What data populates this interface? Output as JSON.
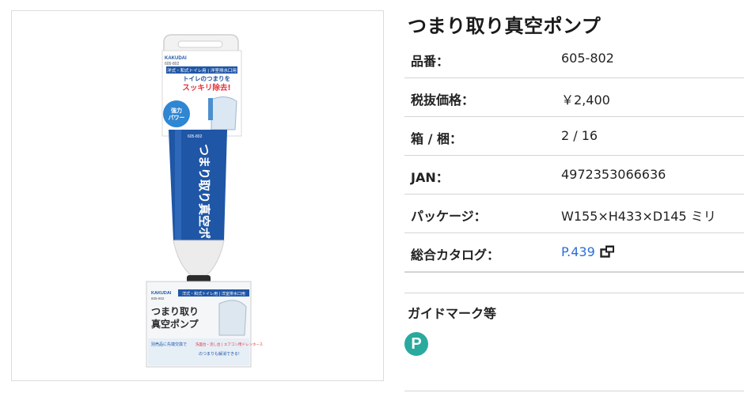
{
  "product": {
    "title": "つまり取り真空ポンプ",
    "image_alt": "つまり取り真空ポンプ",
    "package": {
      "brand": "KAKUDAI",
      "model": "605-802",
      "top_banner": "洋式・和式トイレ用 | 洋室排水口用",
      "headline_1": "トイレのつまりを",
      "headline_2": "スッキリ除去!",
      "badge_line1": "強力",
      "badge_line2": "パワー",
      "tube_text": "つまり取り真空ポンプ",
      "tube_model": "605-802",
      "base_tag": "洋式・和式トイレ用 | 洋室排水口用",
      "base_title_1": "つまり取り",
      "base_title_2": "真空ポンプ",
      "base_note_1": "別売品に先端交換で",
      "base_note_2": "洗面台・流し台 | エアコン用ドレンホース",
      "base_note_3": "のつまりも解消できる!"
    }
  },
  "specs": [
    {
      "label": "品番：",
      "value": "605-802"
    },
    {
      "label": "税抜価格：",
      "value": "￥2,400"
    },
    {
      "label": "箱 / 梱：",
      "value": "2 / 16"
    },
    {
      "label": "JAN：",
      "value": "4972353066636"
    },
    {
      "label": "パッケージ：",
      "value": "W155×H433×D145 ミリ"
    },
    {
      "label": "総合カタログ：",
      "value": "P.439",
      "link": true,
      "icon": "external-window-icon"
    }
  ],
  "guide": {
    "title": "ガイドマーク等",
    "marks": [
      {
        "icon": "p-mark-icon",
        "text": "P",
        "color": "#2aa99e"
      }
    ]
  },
  "colors": {
    "link": "#2a6fd6",
    "tube_blue": "#1f56a6",
    "badge_blue": "#2f86d2",
    "headline_red": "#e2313b"
  }
}
